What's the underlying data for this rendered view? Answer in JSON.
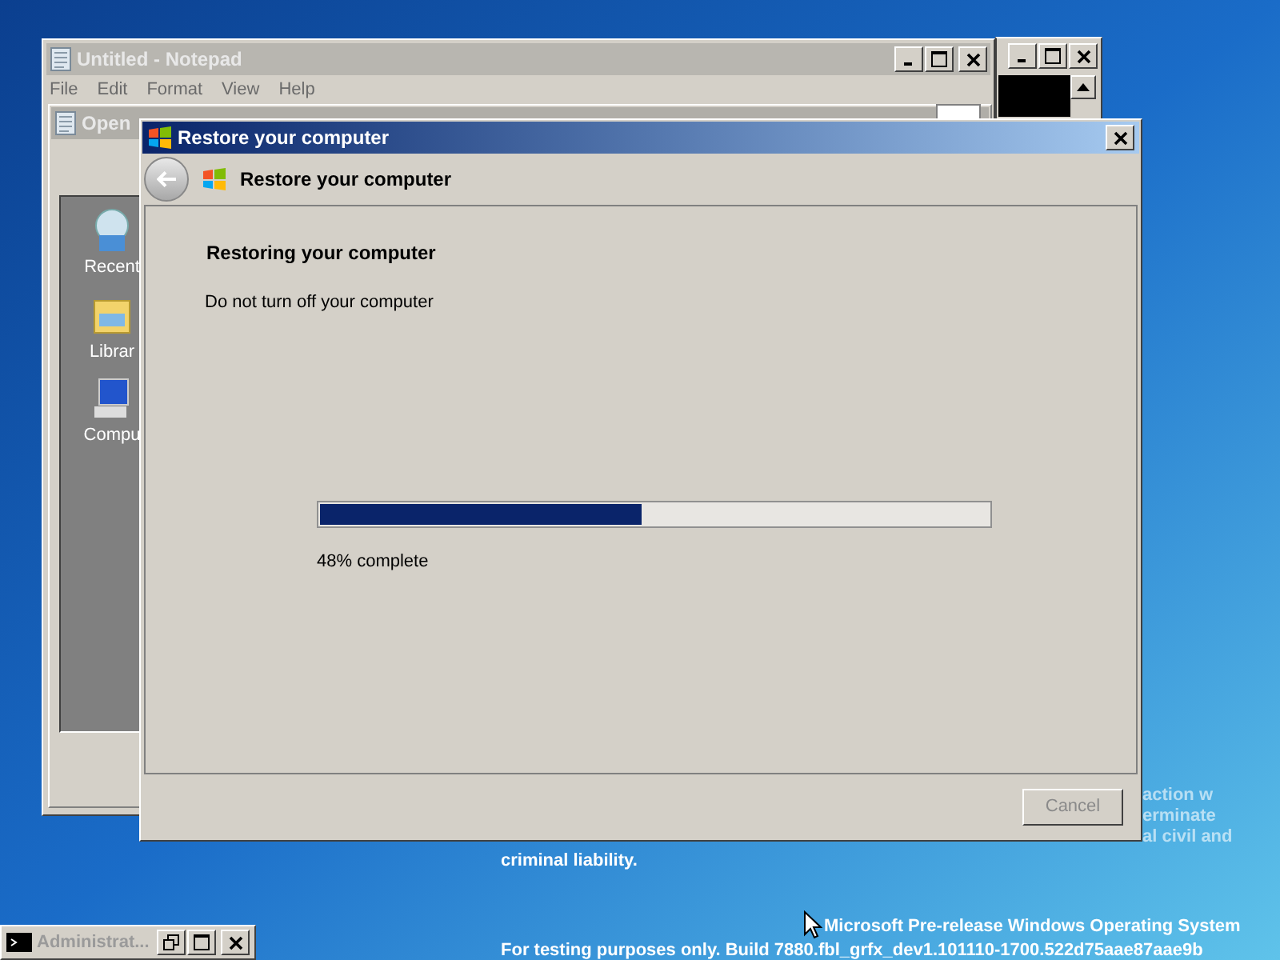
{
  "notepad": {
    "title": "Untitled - Notepad",
    "menu": [
      "File",
      "Edit",
      "Format",
      "View",
      "Help"
    ]
  },
  "open_dialog": {
    "title": "Open",
    "places": [
      {
        "label": "Recent"
      },
      {
        "label": "Librar"
      },
      {
        "label": "Compu"
      }
    ]
  },
  "console_minimized": {
    "title": "Administrat..."
  },
  "dialog": {
    "title": "Restore your computer",
    "header": "Restore your computer",
    "heading": "Restoring your computer",
    "message": "Do not turn off your computer",
    "progress": {
      "level": 0.48,
      "reading": "48% complete"
    },
    "buttons": [
      {
        "label": "Cancel",
        "disabled": true
      }
    ]
  },
  "desktop_text": {
    "partial_lines": [
      "action w",
      "erminate",
      "al civil and"
    ],
    "liability": "criminal liability.",
    "watermark_line1": "Microsoft Pre-release Windows Operating System",
    "watermark_line2": "For testing purposes only. Build 7880.fbl_grfx_dev1.101110-1700.522d75aae87aae9b"
  }
}
